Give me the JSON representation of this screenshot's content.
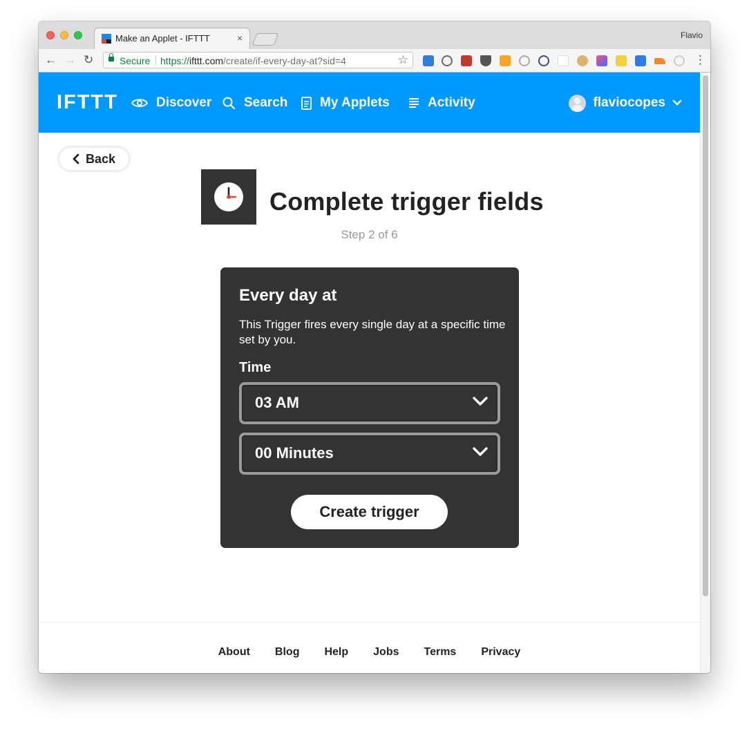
{
  "browser": {
    "tab_title": "Make an Applet - IFTTT",
    "tab_close": "×",
    "profile_name": "Flavio",
    "secure_label": "Secure",
    "url_scheme": "https://",
    "url_host": "ifttt.com",
    "url_path": "/create/if-every-day-at?sid=4",
    "bookmark_icon": "star-icon"
  },
  "header": {
    "logo": "IFTTT",
    "nav": [
      {
        "label": "Discover",
        "icon": "eye-icon"
      },
      {
        "label": "Search",
        "icon": "search-icon"
      },
      {
        "label": "My Applets",
        "icon": "document-icon"
      },
      {
        "label": "Activity",
        "icon": "list-icon"
      }
    ],
    "username": "flaviocopes",
    "brand_color": "#0099ff"
  },
  "page": {
    "back_label": "Back",
    "title": "Complete trigger fields",
    "step": "Step 2 of 6",
    "service_icon": "clock-icon"
  },
  "trigger": {
    "title": "Every day at",
    "description": "This Trigger fires every single day at a specific time set by you.",
    "field_label": "Time",
    "hour_value": "03 AM",
    "minute_value": "00 Minutes",
    "submit_label": "Create trigger",
    "card_color": "#333333"
  },
  "footer": {
    "links": [
      "About",
      "Blog",
      "Help",
      "Jobs",
      "Terms",
      "Privacy"
    ]
  }
}
